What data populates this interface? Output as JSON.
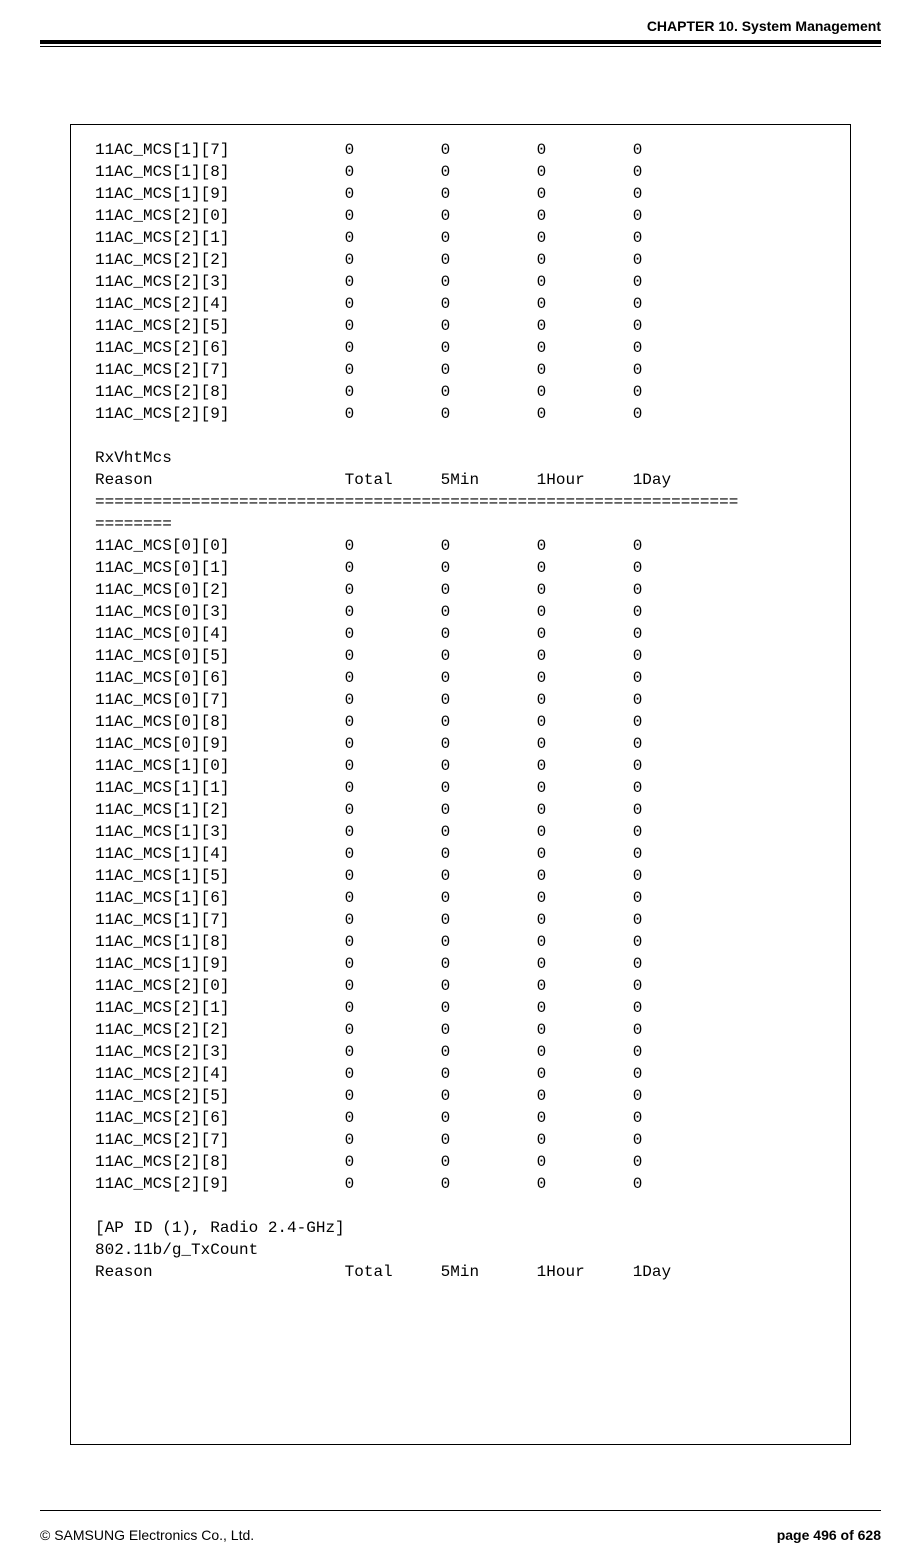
{
  "header": {
    "chapter": "CHAPTER 10. System Management"
  },
  "footer": {
    "copyright": "© SAMSUNG Electronics Co., Ltd.",
    "page_label": "page 496 of 628"
  },
  "block1_rows": [
    {
      "name": "11AC_MCS[1][7]",
      "total": 0,
      "m5": 0,
      "h1": 0,
      "d1": 0
    },
    {
      "name": "11AC_MCS[1][8]",
      "total": 0,
      "m5": 0,
      "h1": 0,
      "d1": 0
    },
    {
      "name": "11AC_MCS[1][9]",
      "total": 0,
      "m5": 0,
      "h1": 0,
      "d1": 0
    },
    {
      "name": "11AC_MCS[2][0]",
      "total": 0,
      "m5": 0,
      "h1": 0,
      "d1": 0
    },
    {
      "name": "11AC_MCS[2][1]",
      "total": 0,
      "m5": 0,
      "h1": 0,
      "d1": 0
    },
    {
      "name": "11AC_MCS[2][2]",
      "total": 0,
      "m5": 0,
      "h1": 0,
      "d1": 0
    },
    {
      "name": "11AC_MCS[2][3]",
      "total": 0,
      "m5": 0,
      "h1": 0,
      "d1": 0
    },
    {
      "name": "11AC_MCS[2][4]",
      "total": 0,
      "m5": 0,
      "h1": 0,
      "d1": 0
    },
    {
      "name": "11AC_MCS[2][5]",
      "total": 0,
      "m5": 0,
      "h1": 0,
      "d1": 0
    },
    {
      "name": "11AC_MCS[2][6]",
      "total": 0,
      "m5": 0,
      "h1": 0,
      "d1": 0
    },
    {
      "name": "11AC_MCS[2][7]",
      "total": 0,
      "m5": 0,
      "h1": 0,
      "d1": 0
    },
    {
      "name": "11AC_MCS[2][8]",
      "total": 0,
      "m5": 0,
      "h1": 0,
      "d1": 0
    },
    {
      "name": "11AC_MCS[2][9]",
      "total": 0,
      "m5": 0,
      "h1": 0,
      "d1": 0
    }
  ],
  "block2_title": "RxVhtMcs",
  "columns_line": "Reason                    Total     5Min      1Hour     1Day",
  "divider_eq": "============================================================================",
  "block2_rows": [
    {
      "name": "11AC_MCS[0][0]",
      "total": 0,
      "m5": 0,
      "h1": 0,
      "d1": 0
    },
    {
      "name": "11AC_MCS[0][1]",
      "total": 0,
      "m5": 0,
      "h1": 0,
      "d1": 0
    },
    {
      "name": "11AC_MCS[0][2]",
      "total": 0,
      "m5": 0,
      "h1": 0,
      "d1": 0
    },
    {
      "name": "11AC_MCS[0][3]",
      "total": 0,
      "m5": 0,
      "h1": 0,
      "d1": 0
    },
    {
      "name": "11AC_MCS[0][4]",
      "total": 0,
      "m5": 0,
      "h1": 0,
      "d1": 0
    },
    {
      "name": "11AC_MCS[0][5]",
      "total": 0,
      "m5": 0,
      "h1": 0,
      "d1": 0
    },
    {
      "name": "11AC_MCS[0][6]",
      "total": 0,
      "m5": 0,
      "h1": 0,
      "d1": 0
    },
    {
      "name": "11AC_MCS[0][7]",
      "total": 0,
      "m5": 0,
      "h1": 0,
      "d1": 0
    },
    {
      "name": "11AC_MCS[0][8]",
      "total": 0,
      "m5": 0,
      "h1": 0,
      "d1": 0
    },
    {
      "name": "11AC_MCS[0][9]",
      "total": 0,
      "m5": 0,
      "h1": 0,
      "d1": 0
    },
    {
      "name": "11AC_MCS[1][0]",
      "total": 0,
      "m5": 0,
      "h1": 0,
      "d1": 0
    },
    {
      "name": "11AC_MCS[1][1]",
      "total": 0,
      "m5": 0,
      "h1": 0,
      "d1": 0
    },
    {
      "name": "11AC_MCS[1][2]",
      "total": 0,
      "m5": 0,
      "h1": 0,
      "d1": 0
    },
    {
      "name": "11AC_MCS[1][3]",
      "total": 0,
      "m5": 0,
      "h1": 0,
      "d1": 0
    },
    {
      "name": "11AC_MCS[1][4]",
      "total": 0,
      "m5": 0,
      "h1": 0,
      "d1": 0
    },
    {
      "name": "11AC_MCS[1][5]",
      "total": 0,
      "m5": 0,
      "h1": 0,
      "d1": 0
    },
    {
      "name": "11AC_MCS[1][6]",
      "total": 0,
      "m5": 0,
      "h1": 0,
      "d1": 0
    },
    {
      "name": "11AC_MCS[1][7]",
      "total": 0,
      "m5": 0,
      "h1": 0,
      "d1": 0
    },
    {
      "name": "11AC_MCS[1][8]",
      "total": 0,
      "m5": 0,
      "h1": 0,
      "d1": 0
    },
    {
      "name": "11AC_MCS[1][9]",
      "total": 0,
      "m5": 0,
      "h1": 0,
      "d1": 0
    },
    {
      "name": "11AC_MCS[2][0]",
      "total": 0,
      "m5": 0,
      "h1": 0,
      "d1": 0
    },
    {
      "name": "11AC_MCS[2][1]",
      "total": 0,
      "m5": 0,
      "h1": 0,
      "d1": 0
    },
    {
      "name": "11AC_MCS[2][2]",
      "total": 0,
      "m5": 0,
      "h1": 0,
      "d1": 0
    },
    {
      "name": "11AC_MCS[2][3]",
      "total": 0,
      "m5": 0,
      "h1": 0,
      "d1": 0
    },
    {
      "name": "11AC_MCS[2][4]",
      "total": 0,
      "m5": 0,
      "h1": 0,
      "d1": 0
    },
    {
      "name": "11AC_MCS[2][5]",
      "total": 0,
      "m5": 0,
      "h1": 0,
      "d1": 0
    },
    {
      "name": "11AC_MCS[2][6]",
      "total": 0,
      "m5": 0,
      "h1": 0,
      "d1": 0
    },
    {
      "name": "11AC_MCS[2][7]",
      "total": 0,
      "m5": 0,
      "h1": 0,
      "d1": 0
    },
    {
      "name": "11AC_MCS[2][8]",
      "total": 0,
      "m5": 0,
      "h1": 0,
      "d1": 0
    },
    {
      "name": "11AC_MCS[2][9]",
      "total": 0,
      "m5": 0,
      "h1": 0,
      "d1": 0
    }
  ],
  "block3_header": "[AP ID (1), Radio 2.4-GHz]",
  "block3_title": "802.11b/g_TxCount"
}
